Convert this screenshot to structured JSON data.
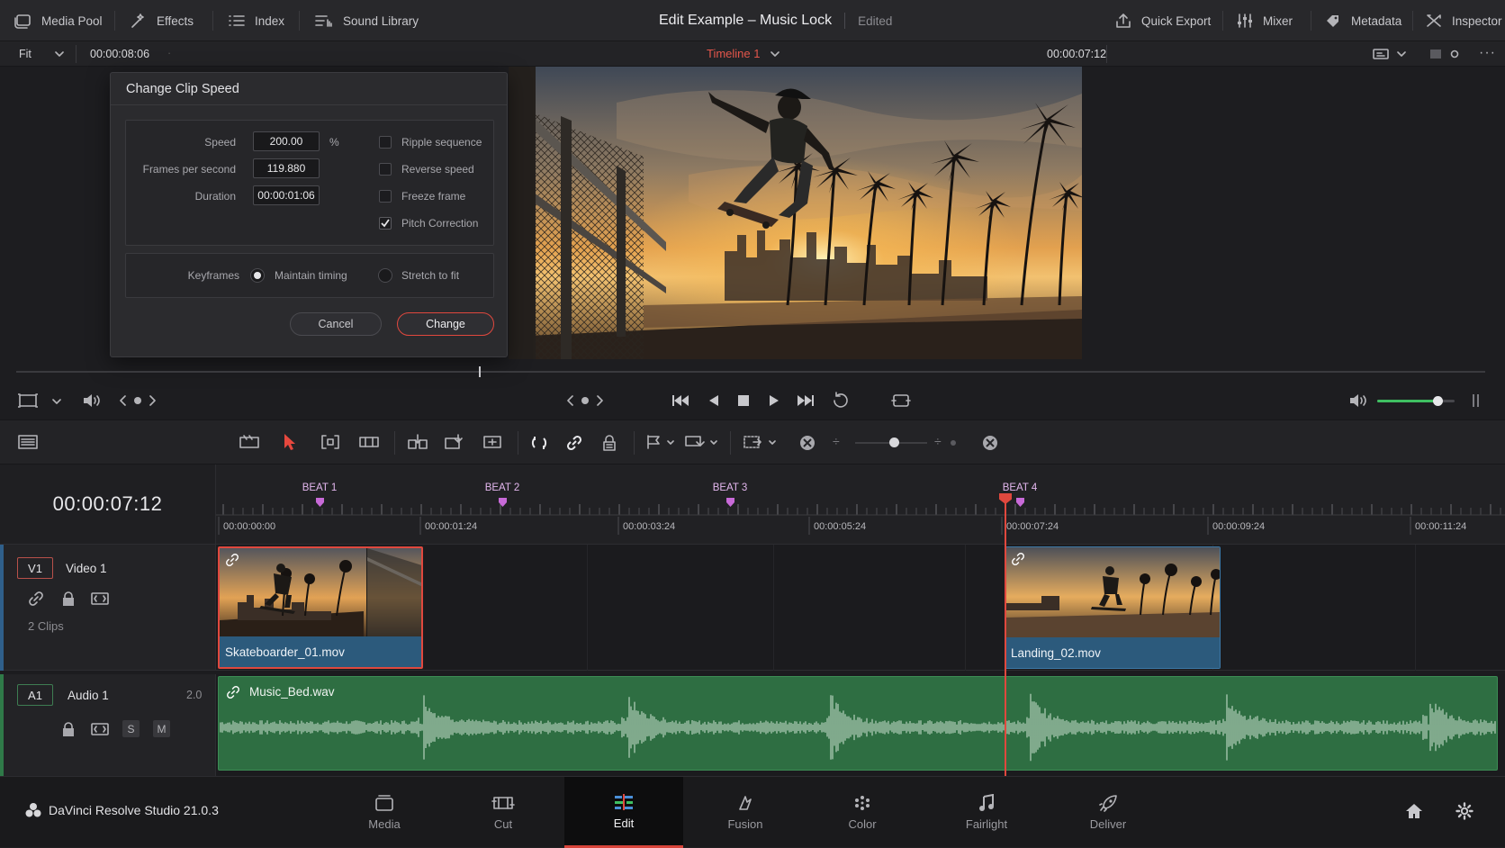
{
  "topbar": {
    "media_pool": "Media Pool",
    "effects": "Effects",
    "index": "Index",
    "sound_library": "Sound Library",
    "project_title": "Edit Example – Music Lock",
    "project_status": "Edited",
    "quick_export": "Quick Export",
    "mixer": "Mixer",
    "metadata": "Metadata",
    "inspector": "Inspector"
  },
  "viewer_bar": {
    "zoom": "Fit",
    "source_timecode": "00:00:08:06",
    "timeline_name": "Timeline 1",
    "record_timecode": "00:00:07:12"
  },
  "dialog": {
    "title": "Change Clip Speed",
    "speed_label": "Speed",
    "speed_value": "200.00",
    "speed_unit": "%",
    "fps_label": "Frames per second",
    "fps_value": "119.880",
    "duration_label": "Duration",
    "duration_value": "00:00:01:06",
    "ripple_label": "Ripple sequence",
    "ripple_checked": false,
    "reverse_label": "Reverse speed",
    "reverse_checked": false,
    "freeze_label": "Freeze frame",
    "freeze_checked": false,
    "pitch_label": "Pitch Correction",
    "pitch_checked": true,
    "keyframes_label": "Keyframes",
    "maintain_label": "Maintain timing",
    "stretch_label": "Stretch to fit",
    "keyframes_selected": "Maintain timing",
    "cancel": "Cancel",
    "change": "Change"
  },
  "audio_level": 0.78,
  "timeline": {
    "current_timecode": "00:00:07:12",
    "markers": [
      "BEAT 1",
      "BEAT 2",
      "BEAT 3",
      "BEAT 4"
    ],
    "ruler_labels": [
      "00:00:00:00",
      "00:00:01:24",
      "00:00:03:24",
      "00:00:05:24",
      "00:00:07:24",
      "00:00:09:24",
      "00:00:11:24"
    ],
    "video_track": {
      "badge": "V1",
      "name": "Video 1",
      "clip_count": "2 Clips",
      "clips": [
        "Skateboarder_01.mov",
        "Landing_02.mov"
      ]
    },
    "audio_track": {
      "badge": "A1",
      "name": "Audio 1",
      "channels": "2.0",
      "solo": "S",
      "mute": "M",
      "clip": "Music_Bed.wav"
    }
  },
  "bottombar": {
    "app_name": "DaVinci Resolve Studio 21.0.3",
    "pages": [
      "Media",
      "Cut",
      "Edit",
      "Fusion",
      "Color",
      "Fairlight",
      "Deliver"
    ],
    "active_page": "Edit"
  },
  "colors": {
    "accent_red": "#e0483e",
    "marker_purple": "#c86ad8",
    "clip_blue": "#2c5a7c",
    "audio_green": "#2e6e42",
    "active_page_red": "#d8443a"
  }
}
